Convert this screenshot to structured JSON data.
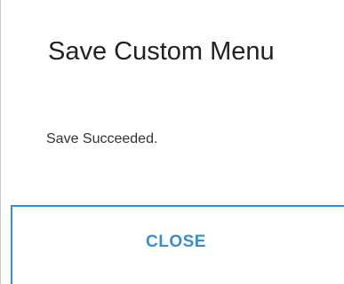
{
  "dialog": {
    "title": "Save Custom Menu",
    "message": "Save Succeeded.",
    "close_label": "CLOSE"
  },
  "colors": {
    "accent": "#3a8ecf",
    "title_text": "#222222",
    "body_text": "#333333",
    "background": "#ffffff",
    "border": "#c8c8c8"
  }
}
